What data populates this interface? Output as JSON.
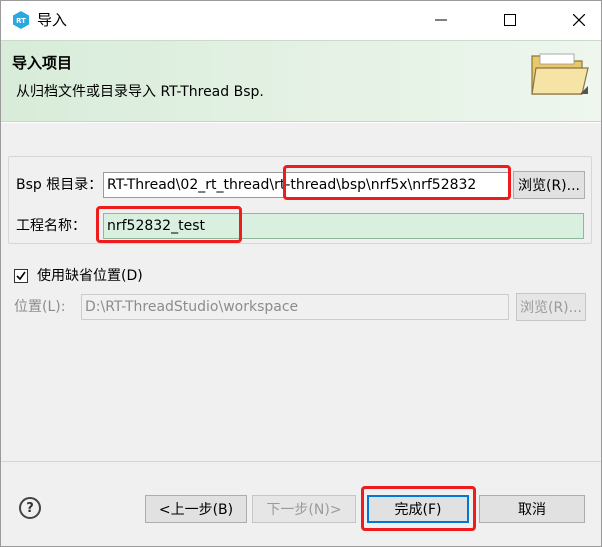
{
  "window": {
    "title": "导入"
  },
  "header": {
    "title": "导入项目",
    "description": "从归档文件或目录导入 RT-Thread Bsp."
  },
  "form": {
    "bsp_root_label": "Bsp 根目录：",
    "bsp_root_value": "RT-Thread\\02_rt_thread\\rt-thread\\bsp\\nrf5x\\nrf52832",
    "browse_label": "浏览(R)...",
    "project_name_label": "工程名称：",
    "project_name_value": "nrf52832_test",
    "use_default_label": "使用缺省位置(D)",
    "use_default_checked": true,
    "location_label": "位置(L):",
    "location_value": "D:\\RT-ThreadStudio\\workspace",
    "location_browse_label": "浏览(R)..."
  },
  "footer": {
    "back_label": "<上一步(B)",
    "next_label": "下一步(N)>",
    "finish_label": "完成(F)",
    "cancel_label": "取消"
  },
  "colors": {
    "accent_green": "#d8ecd9",
    "highlight_red": "#ee1c1c",
    "selected_field": "#d9efe0"
  },
  "icons": {
    "app": "rt-thread-logo-icon",
    "header": "folder-open-icon",
    "help": "help-icon"
  }
}
